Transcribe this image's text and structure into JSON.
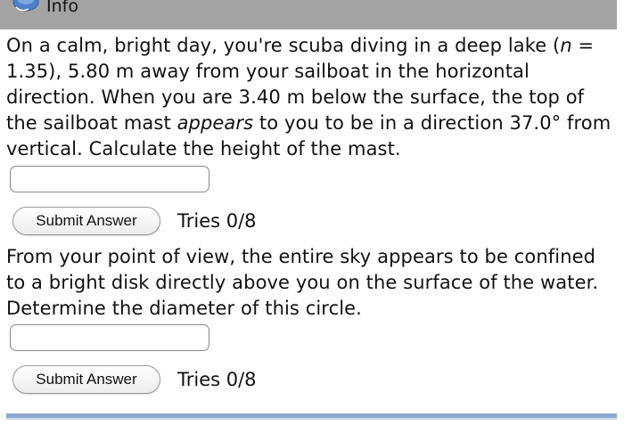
{
  "header": {
    "title": "Info",
    "icon": "info-badge-icon"
  },
  "questions": [
    {
      "text_before_n": "On a calm, bright day, you're scuba diving in a deep lake (",
      "n_symbol": "n",
      "text_after_n": " = 1.35), 5.80 m away from your sailboat in the horizontal direction. When you are 3.40 m below the surface, the top of the sailboat mast ",
      "emphasis": "appears",
      "text_after_emphasis": " to you to be in a direction 37.0° from vertical. Calculate the height of the mast.",
      "input_value": "",
      "submit_label": "Submit Answer",
      "tries": "Tries 0/8"
    },
    {
      "text": "From your point of view, the entire sky appears to be confined to a bright disk directly above you on the surface of the water. Determine the diameter of this circle.",
      "input_value": "",
      "submit_label": "Submit Answer",
      "tries": "Tries 0/8"
    }
  ],
  "colors": {
    "header_bar": "#a3a3a3",
    "bottom_rule": "#8fa8d0"
  }
}
